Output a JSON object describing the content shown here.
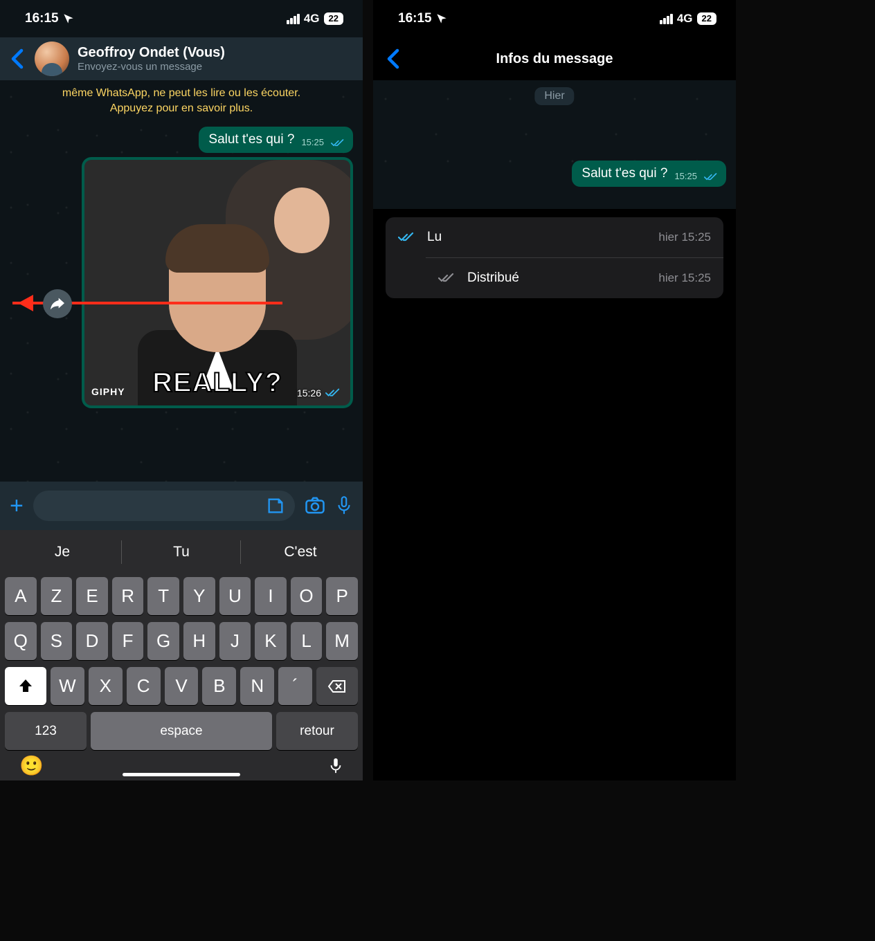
{
  "status": {
    "time": "16:15",
    "network": "4G",
    "battery": "22"
  },
  "chat": {
    "contact_name": "Geoffroy Ondet (Vous)",
    "contact_sub": "Envoyez-vous un message",
    "encryption_banner": "même WhatsApp, ne peut les lire ou les écouter. Appuyez pour en savoir plus.",
    "msg1_text": "Salut t'es qui ?",
    "msg1_time": "15:25",
    "gif_caption": "REALLY?",
    "gif_source": "GIPHY",
    "gif_time": "15:26"
  },
  "keyboard": {
    "suggest1": "Je",
    "suggest2": "Tu",
    "suggest3": "C'est",
    "row1": [
      "A",
      "Z",
      "E",
      "R",
      "T",
      "Y",
      "U",
      "I",
      "O",
      "P"
    ],
    "row2": [
      "Q",
      "S",
      "D",
      "F",
      "G",
      "H",
      "J",
      "K",
      "L",
      "M"
    ],
    "row3": [
      "W",
      "X",
      "C",
      "V",
      "B",
      "N",
      "´"
    ],
    "num_key": "123",
    "space_key": "espace",
    "return_key": "retour"
  },
  "info": {
    "title": "Infos du message",
    "date_label": "Hier",
    "bubble_text": "Salut t'es qui ?",
    "bubble_time": "15:25",
    "read_label": "Lu",
    "read_time": "hier 15:25",
    "delivered_label": "Distribué",
    "delivered_time": "hier 15:25"
  }
}
